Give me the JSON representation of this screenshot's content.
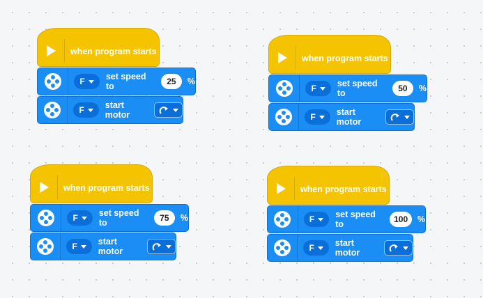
{
  "stacks": [
    {
      "hat_label": "when program starts",
      "speed_label": "set speed to",
      "port": "F",
      "speed": "25",
      "unit": "%",
      "start_label": "start motor",
      "start_port": "F"
    },
    {
      "hat_label": "when program starts",
      "speed_label": "set speed to",
      "port": "F",
      "speed": "50",
      "unit": "%",
      "start_label": "start motor",
      "start_port": "F"
    },
    {
      "hat_label": "when program starts",
      "speed_label": "set speed to",
      "port": "F",
      "speed": "75",
      "unit": "%",
      "start_label": "start motor",
      "start_port": "F"
    },
    {
      "hat_label": "when program starts",
      "speed_label": "set speed to",
      "port": "F",
      "speed": "100",
      "unit": "%",
      "start_label": "start motor",
      "start_port": "F"
    }
  ],
  "icons": {
    "hat": "play-icon",
    "motor": "motor-icon",
    "dropdown": "chevron-down-icon",
    "direction": "clockwise-arrow-icon"
  },
  "colors": {
    "event_block": "#f5c400",
    "motor_block": "#1a8ef5",
    "canvas": "#f5f6f8"
  }
}
